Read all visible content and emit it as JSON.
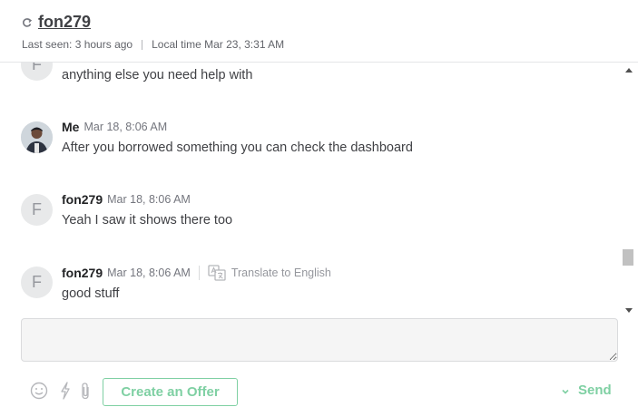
{
  "header": {
    "username": "fon279",
    "last_seen": "Last seen: 3 hours ago",
    "local_time": "Local time Mar 23, 3:31 AM"
  },
  "messages": [
    {
      "avatar_letter": "F",
      "text": "anything else you need help with"
    },
    {
      "sender": "Me",
      "time": "Mar 18, 8:06 AM",
      "text": "After you borrowed something you can check the dashboard",
      "avatar": "user-photo"
    },
    {
      "avatar_letter": "F",
      "sender": "fon279",
      "time": "Mar 18, 8:06 AM",
      "text": "Yeah I saw it shows there too"
    },
    {
      "avatar_letter": "F",
      "sender": "fon279",
      "time": "Mar 18, 8:06 AM",
      "text": "good stuff",
      "translate_label": "Translate to English"
    }
  ],
  "composer": {
    "placeholder": ""
  },
  "toolbar": {
    "emoji_icon": "smiley-icon",
    "quick_response_icon": "lightning-icon",
    "attach_icon": "paperclip-icon",
    "offer_label": "Create an Offer",
    "send_label": "Send"
  },
  "colors": {
    "accent": "#7fd0a3",
    "avatar_bg": "#e8e9ea",
    "composer_bg": "#f5f5f5"
  }
}
